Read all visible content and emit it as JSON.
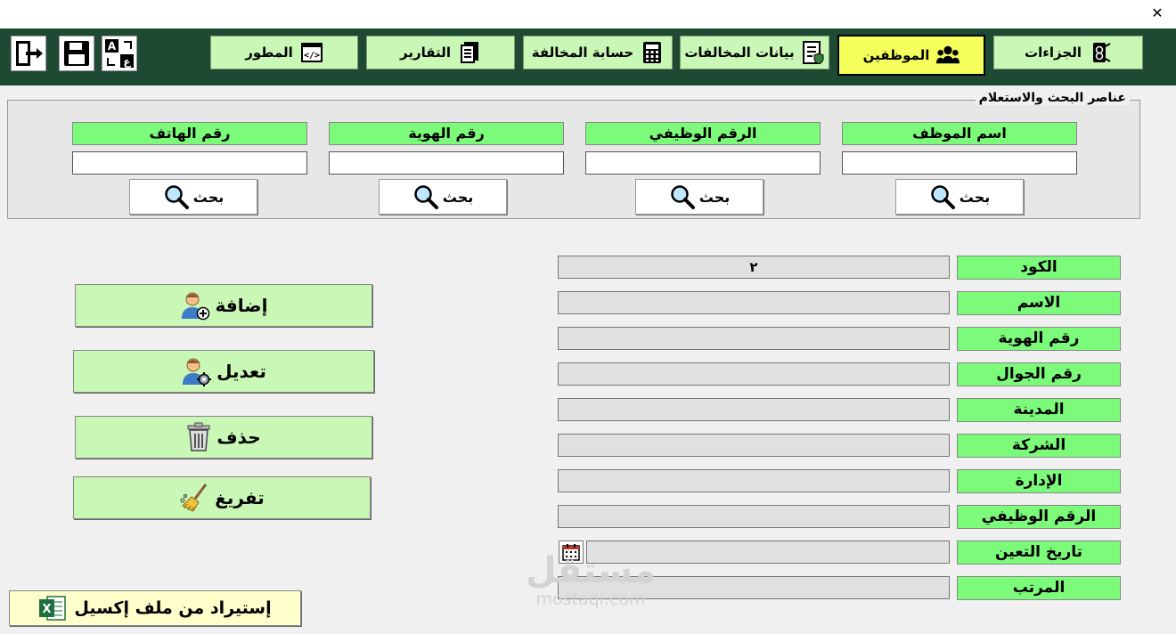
{
  "window": {
    "close_glyph": "✕"
  },
  "toolbar_icons": [
    "exit-icon",
    "save-icon",
    "translate-icon"
  ],
  "nav": {
    "developer": "المطور",
    "reports": "التقارير",
    "violation_calc": "حسابة المخالفة",
    "violations_data": "بيانات المخالفات",
    "employees": "الموظفين",
    "penalties": "الجزاءات"
  },
  "search": {
    "group_title": "عناصر البحث والاستعلام",
    "fields": {
      "phone": "رقم الهاتف",
      "id_number": "رقم الهوية",
      "job_number": "الرقم الوظيفي",
      "employee_name": "اسم الموظف"
    },
    "button_label": "بحث"
  },
  "form": {
    "code_label": "الكود",
    "code_value": "٢",
    "name_label": "الاسم",
    "id_label": "رقم الهوية",
    "mobile_label": "رقم الجوال",
    "city_label": "المدينة",
    "company_label": "الشركة",
    "department_label": "الإدارة",
    "job_number_label": "الرقم الوظيفي",
    "hire_date_label": "تاريخ التعين",
    "salary_label": "المرتب"
  },
  "actions": {
    "add": "إضافة",
    "edit": "تعديل",
    "delete": "حذف",
    "clear": "تفريغ",
    "import_excel": "إستيراد من ملف إكسيل"
  },
  "watermark": {
    "arabic": "مستقل",
    "latin": "mostaql.com"
  },
  "colors": {
    "nav_bg": "#1e4a33",
    "nav_button": "#c9f7b6",
    "nav_active": "#f4ff5c",
    "label_green": "#7cfa7a",
    "import_button": "#ffffcc"
  }
}
